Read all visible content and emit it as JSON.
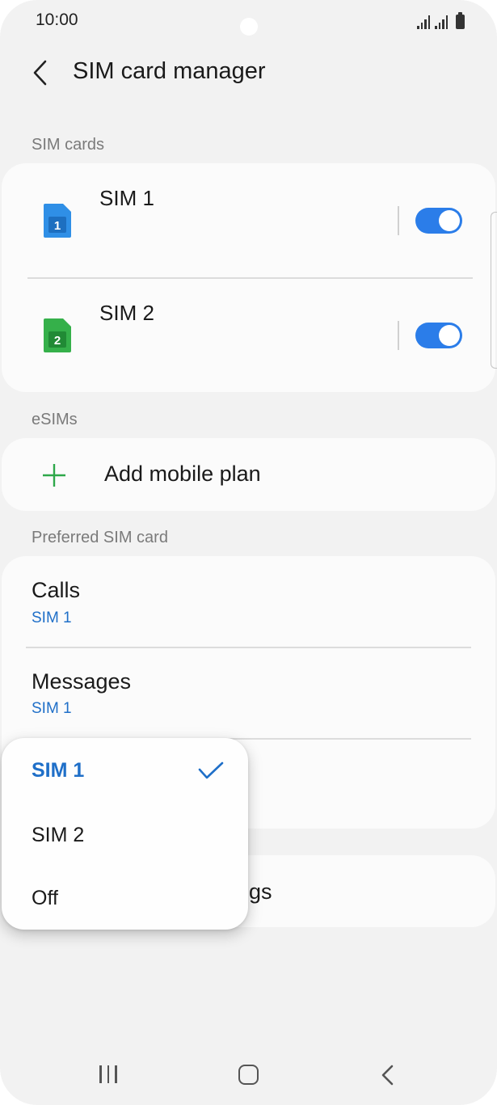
{
  "status_bar": {
    "time": "10:00"
  },
  "header": {
    "title": "SIM card manager"
  },
  "sections": {
    "sim_cards": "SIM cards",
    "esims": "eSIMs",
    "preferred": "Preferred SIM card"
  },
  "sim_cards": [
    {
      "name": "SIM 1",
      "badge": "1",
      "color": "#2f8fe6",
      "enabled": true
    },
    {
      "name": "SIM 2",
      "badge": "2",
      "color": "#35b04a",
      "enabled": true
    }
  ],
  "esim": {
    "add_label": "Add mobile plan"
  },
  "preferred": [
    {
      "title": "Calls",
      "value": "SIM 1"
    },
    {
      "title": "Messages",
      "value": "SIM 1"
    }
  ],
  "more_settings_partial": "gs",
  "popup": {
    "options": [
      "SIM 1",
      "SIM 2",
      "Off"
    ],
    "selected": "SIM 1"
  },
  "colors": {
    "accent": "#2b7de9",
    "link": "#1f6fc8",
    "background": "#f2f2f2",
    "card": "#fbfbfb"
  }
}
